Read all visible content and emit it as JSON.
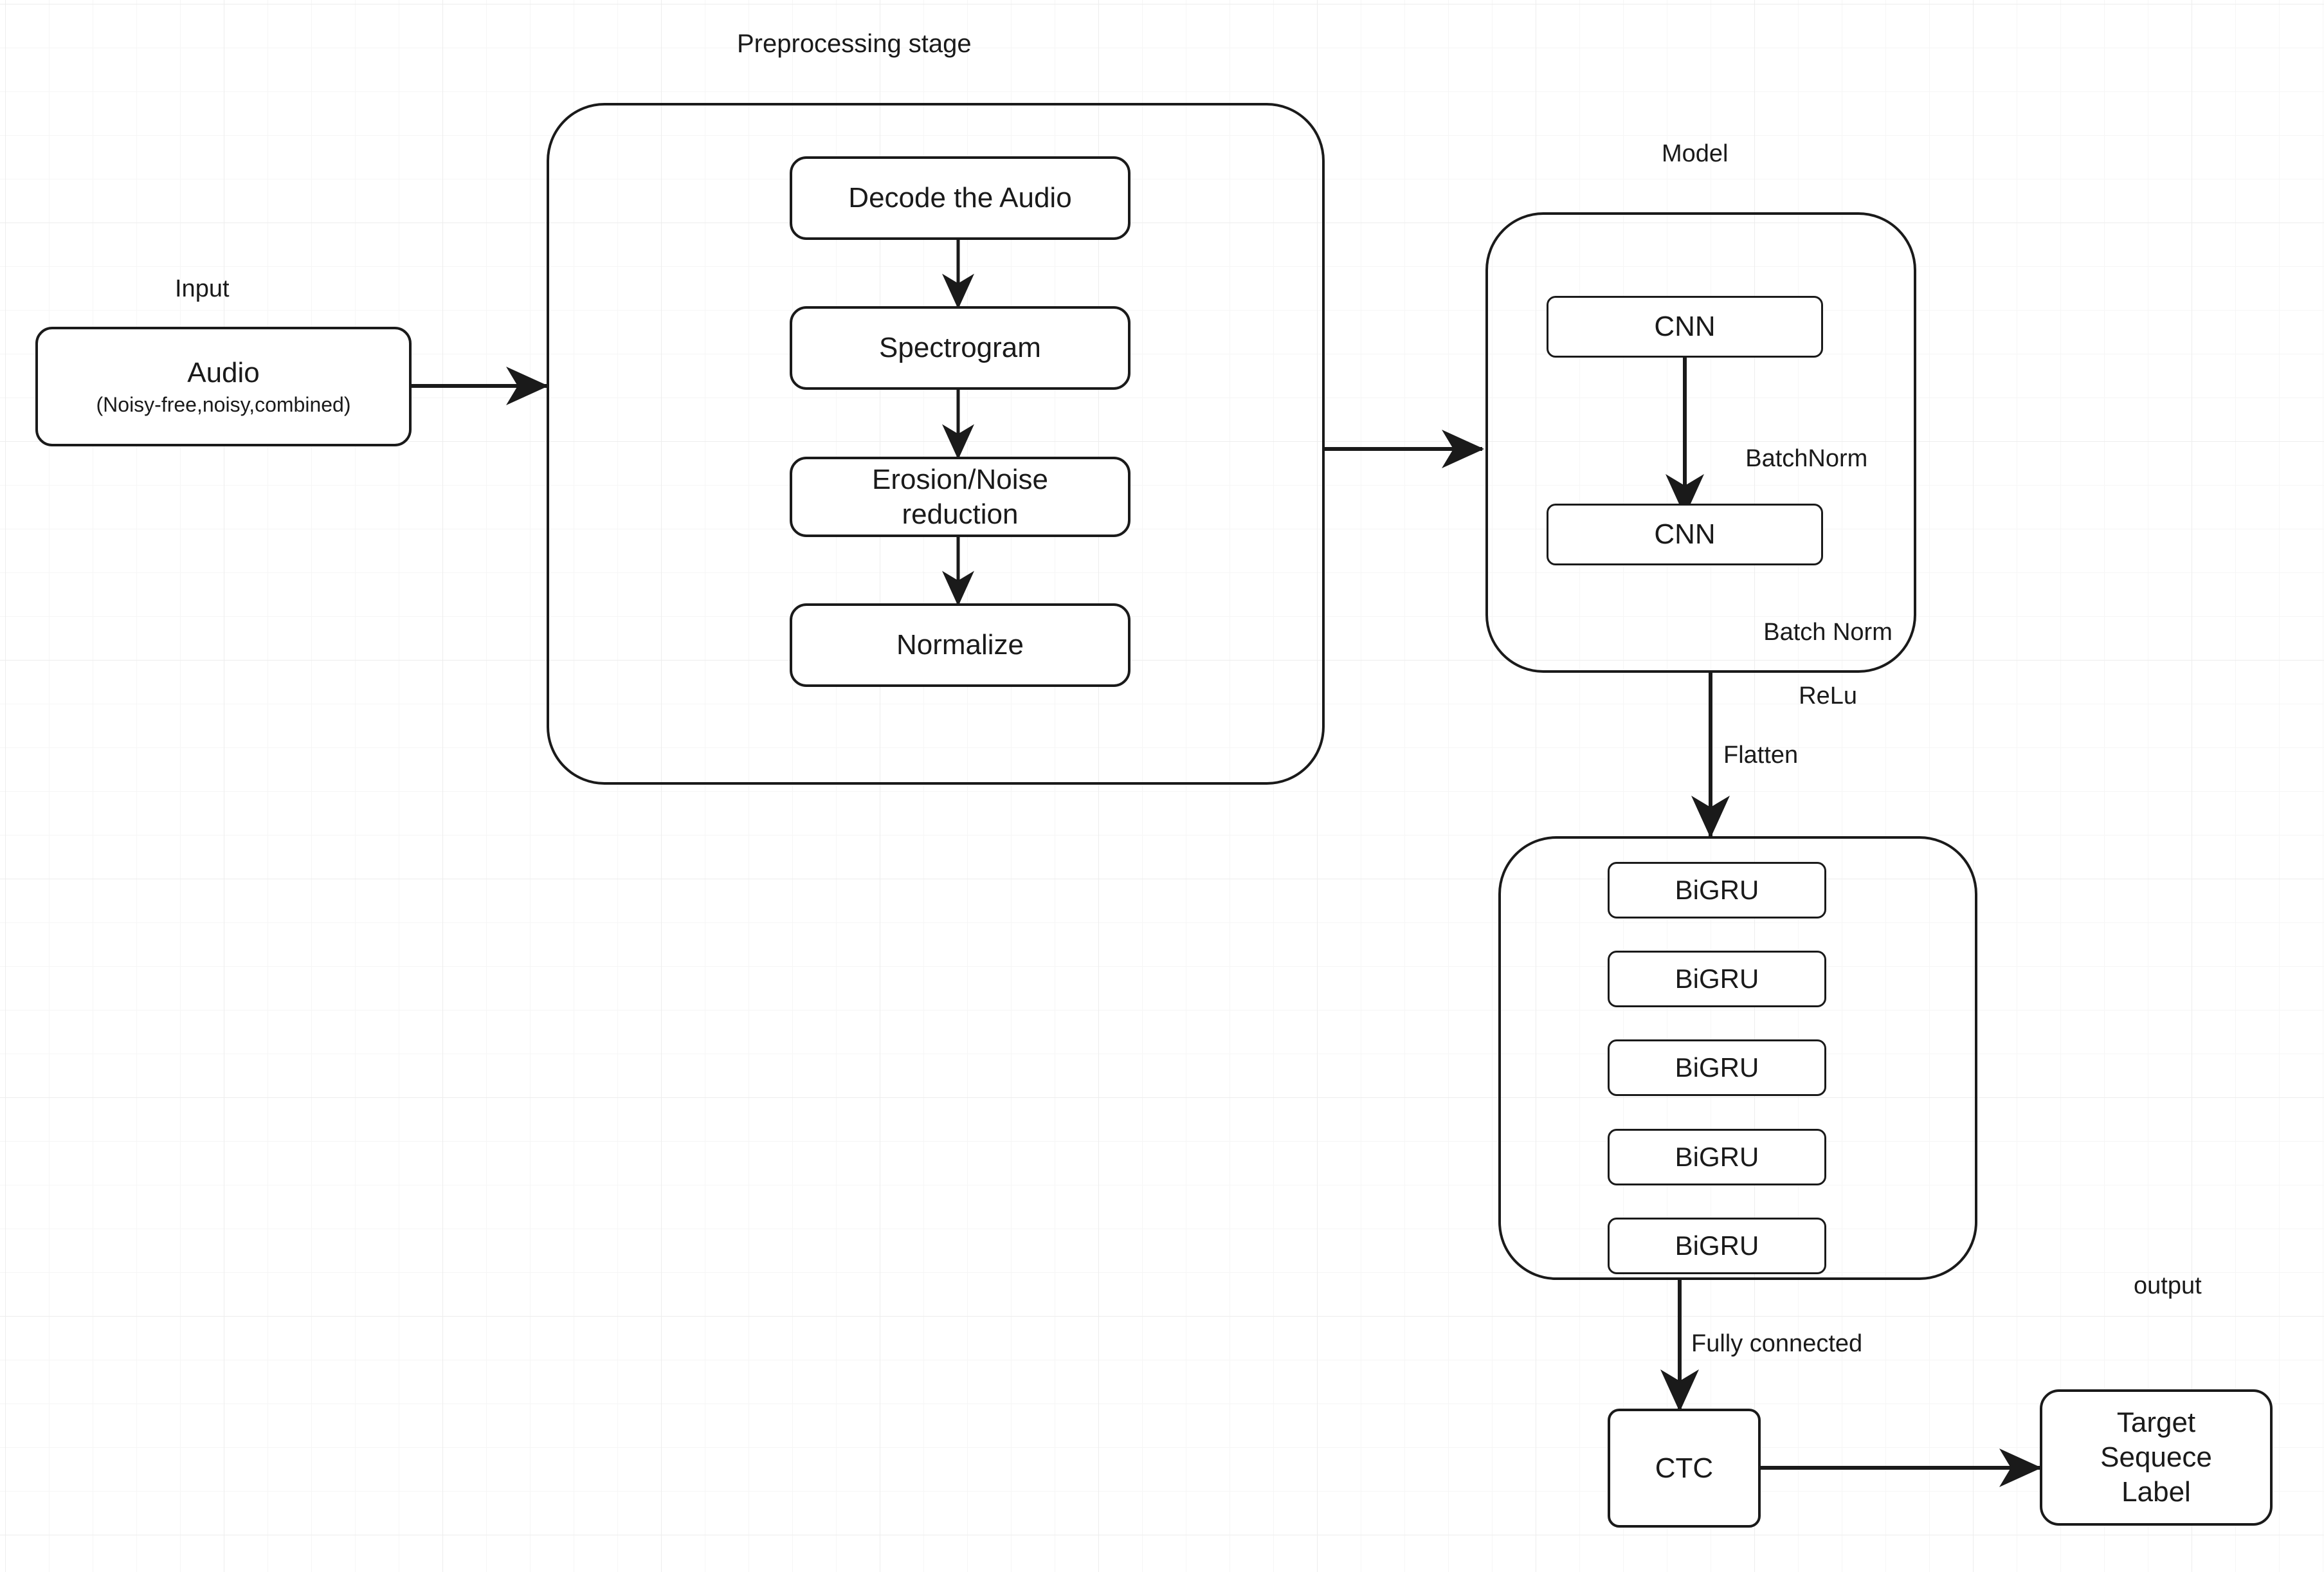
{
  "diagram": {
    "title_hidden": "",
    "captions": {
      "preprocessing_stage": "Preprocessing stage",
      "input": "Input",
      "model": "Model",
      "output": "output",
      "batchnorm_relu_1_line1": "BatchNorm",
      "batchnorm_relu_1_line2": "ReLu",
      "batchnorm_relu_2_line1": "Batch Norm",
      "batchnorm_relu_2_line2": "ReLu",
      "flatten": "Flatten",
      "fully_connected": "Fully connected"
    },
    "input_node": {
      "line1": "Audio",
      "line2": "(Noisy-free,noisy,combined)"
    },
    "preprocessing_steps": [
      {
        "label": "Decode the Audio"
      },
      {
        "label": "Spectrogram"
      },
      {
        "label": "Erosion/Noise",
        "label2": "reduction"
      },
      {
        "label": "Normalize"
      }
    ],
    "model_layers": [
      {
        "label": "CNN"
      },
      {
        "label": "CNN"
      }
    ],
    "rnn_layers": [
      {
        "label": "BiGRU"
      },
      {
        "label": "BiGRU"
      },
      {
        "label": "BiGRU"
      },
      {
        "label": "BiGRU"
      },
      {
        "label": "BiGRU"
      }
    ],
    "loss_node": {
      "label": "CTC"
    },
    "output_node": {
      "line1": "Target",
      "line2": "Sequece",
      "line3": "Label"
    },
    "colors": {
      "stroke": "#1a1a1a",
      "grid_major": "#ededed",
      "grid_minor": "#f6f6f6",
      "background": "#ffffff"
    }
  }
}
